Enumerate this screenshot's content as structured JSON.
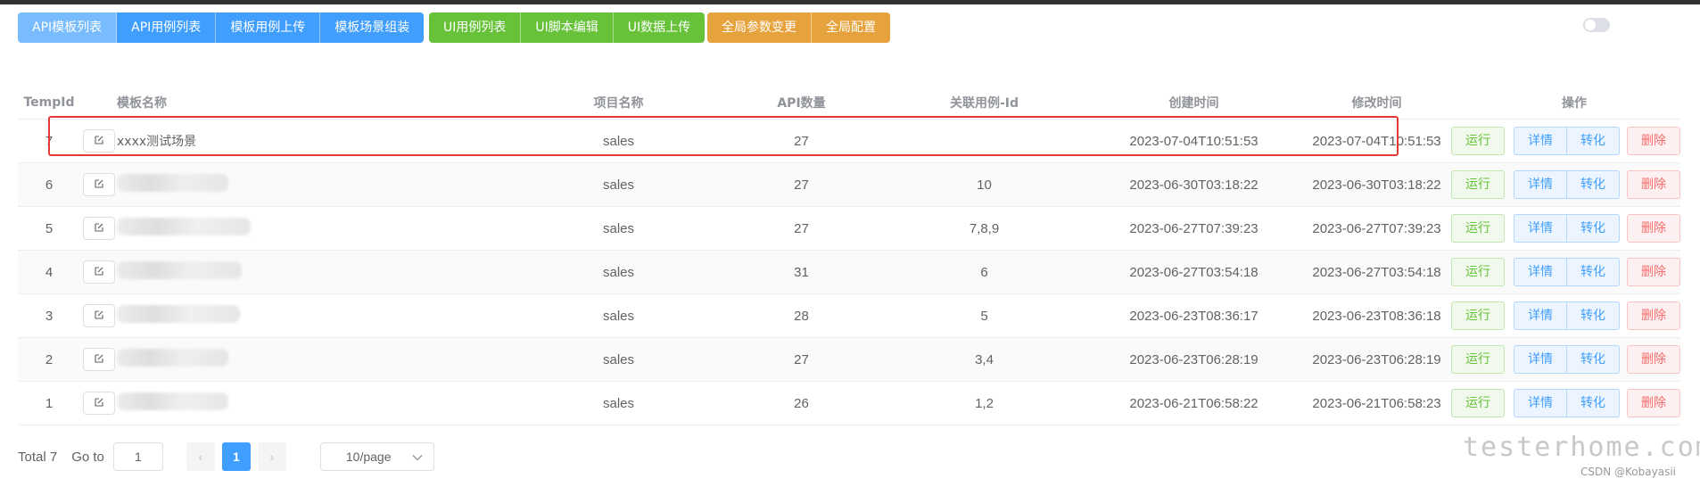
{
  "toolbar": {
    "api_group": [
      "API模板列表",
      "API用例列表",
      "模板用例上传",
      "模板场景组装"
    ],
    "ui_group": [
      "UI用例列表",
      "UI脚本编辑",
      "UI数据上传"
    ],
    "global_group": [
      "全局参数变更",
      "全局配置"
    ],
    "active": "API模板列表"
  },
  "table": {
    "headers": {
      "id": "TempId",
      "name": "模板名称",
      "project": "项目名称",
      "api_count": "API数量",
      "related": "关联用例-Id",
      "created": "创建时间",
      "modified": "修改时间",
      "ops": "操作"
    },
    "rows": [
      {
        "id": "7",
        "name": "xxxx测试场景",
        "project": "sales",
        "api_count": "27",
        "related": "",
        "created": "2023-07-04T10:51:53",
        "modified": "2023-07-04T10:51:53"
      },
      {
        "id": "6",
        "name": "",
        "project": "sales",
        "api_count": "27",
        "related": "10",
        "created": "2023-06-30T03:18:22",
        "modified": "2023-06-30T03:18:22"
      },
      {
        "id": "5",
        "name": "",
        "project": "sales",
        "api_count": "27",
        "related": "7,8,9",
        "created": "2023-06-27T07:39:23",
        "modified": "2023-06-27T07:39:23"
      },
      {
        "id": "4",
        "name": "",
        "project": "sales",
        "api_count": "31",
        "related": "6",
        "created": "2023-06-27T03:54:18",
        "modified": "2023-06-27T03:54:18"
      },
      {
        "id": "3",
        "name": "",
        "project": "sales",
        "api_count": "28",
        "related": "5",
        "created": "2023-06-23T08:36:17",
        "modified": "2023-06-23T08:36:18"
      },
      {
        "id": "2",
        "name": "",
        "project": "sales",
        "api_count": "27",
        "related": "3,4",
        "created": "2023-06-23T06:28:19",
        "modified": "2023-06-23T06:28:19"
      },
      {
        "id": "1",
        "name": "",
        "project": "sales",
        "api_count": "26",
        "related": "1,2",
        "created": "2023-06-21T06:58:22",
        "modified": "2023-06-21T06:58:23"
      }
    ],
    "ops_labels": {
      "run": "运行",
      "detail": "详情",
      "convert": "转化",
      "delete": "删除"
    }
  },
  "pagination": {
    "total": "Total 7",
    "goto_label": "Go to",
    "goto_value": "1",
    "current_page": "1",
    "page_size": "10/page"
  },
  "watermark": {
    "site": "testerhome.com",
    "credit": "CSDN @Kobayasii"
  },
  "colors": {
    "primary": "#409eff",
    "success": "#67c23a",
    "warning": "#e6a23c",
    "danger": "#f56c6c",
    "highlight": "#e53935"
  }
}
